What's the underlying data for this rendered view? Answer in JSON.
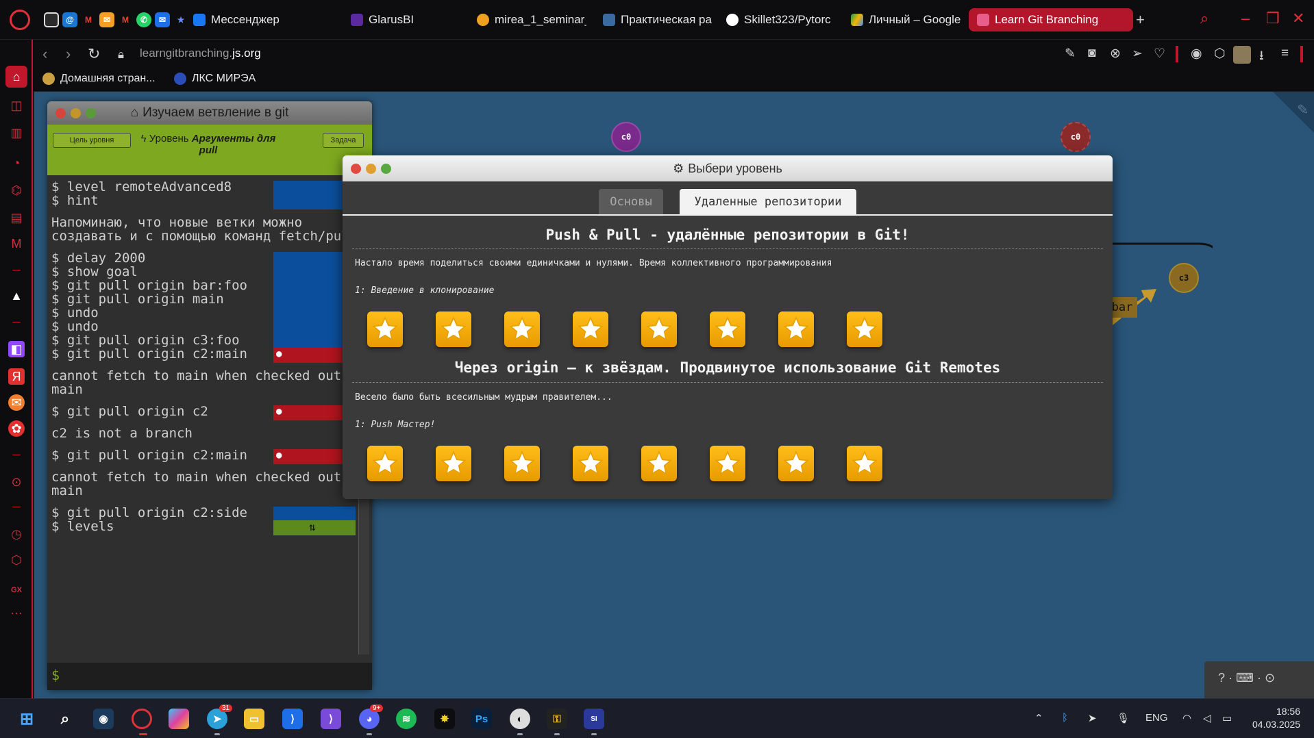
{
  "browser": {
    "tabs": [
      {
        "label": "Мессенджер"
      },
      {
        "label": "GlarusBI"
      },
      {
        "label": "mirea_1_seminar_"
      },
      {
        "label": "Практическая ра"
      },
      {
        "label": "Skillet323/Pytorc"
      },
      {
        "label": "Личный – Google"
      },
      {
        "label": "Learn Git Branching",
        "active": true
      }
    ],
    "new_tab_label": "+",
    "url_prefix": "learngitbranching.",
    "url_domain": "js.org",
    "bookmarks": [
      {
        "label": "Домашняя стран..."
      },
      {
        "label": "ЛКС МИРЭА"
      }
    ]
  },
  "terminal": {
    "title": "Изучаем ветвление в git",
    "goal_button": "Цель уровня",
    "task_button": "Задача",
    "level_prefix": "Уровень",
    "level_name": "Аргументы для pull",
    "lines": [
      {
        "text": "$ level remoteAdvanced8",
        "status": "blue"
      },
      {
        "text": "$ hint",
        "status": "blue"
      },
      {
        "text": "Напоминаю, что новые ветки можно",
        "status": ""
      },
      {
        "text": "создавать и с помощью команд fetch/pull",
        "status": ""
      },
      {
        "text": "$ delay 2000",
        "status": "blue"
      },
      {
        "text": "$ show goal",
        "status": "blue"
      },
      {
        "text": "$ git pull origin bar:foo",
        "status": "blue"
      },
      {
        "text": "$ git pull origin main",
        "status": "blue"
      },
      {
        "text": "$ undo",
        "status": "blue"
      },
      {
        "text": "$ undo",
        "status": "blue"
      },
      {
        "text": "$ git pull origin c3:foo",
        "status": "blue"
      },
      {
        "text": "$ git pull origin c2:main",
        "status": "error"
      },
      {
        "text": "cannot fetch to main when checked out on",
        "status": ""
      },
      {
        "text": "main",
        "status": ""
      },
      {
        "text": "$ git pull origin c2",
        "status": "error"
      },
      {
        "text": "c2 is not a branch",
        "status": ""
      },
      {
        "text": "$ git pull origin c2:main",
        "status": "error"
      },
      {
        "text": "cannot fetch to main when checked out on",
        "status": ""
      },
      {
        "text": "main",
        "status": ""
      },
      {
        "text": "$ git pull origin c2:side",
        "status": "blue"
      },
      {
        "text": "$ levels",
        "status": "green"
      }
    ],
    "prompt": "$"
  },
  "graph": {
    "nodes": [
      {
        "label": "c0",
        "color": "#7a2a8a"
      },
      {
        "label": "c0",
        "color": "#8a2a2a"
      },
      {
        "label": "c3",
        "color": "#8a6a20"
      }
    ],
    "branch_label": "bar"
  },
  "dialog": {
    "title": "Выбери уровень",
    "tabs": [
      {
        "label": "Основы",
        "active": false
      },
      {
        "label": "Удаленные репозитории",
        "active": true
      }
    ],
    "sections": [
      {
        "title": "Push & Pull - удалённые репозитории в Git!",
        "description": "Настало время поделиться своими единичками и нулями. Время коллективного программирования",
        "subtitle": "1: Введение в клонирование",
        "stars": 8
      },
      {
        "title": "Через origin – к звёздам. Продвинутое использование Git Remotes",
        "description": "Весело было быть всесильным мудрым правителем...",
        "subtitle": "1: Push Мастер!",
        "stars": 8
      }
    ]
  },
  "help_box": {
    "text": "? · ⌨ · ⊙"
  },
  "taskbar": {
    "badges": {
      "telegram": "31",
      "discord": "9+"
    },
    "tray_lang": "ENG",
    "time": "18:56",
    "date": "04.03.2025"
  },
  "colors": {
    "accent": "#c0172b",
    "canvas": "#2a5578",
    "level_bar": "#7ea81f",
    "status_blue": "#0b4f9c",
    "status_red": "#b0141e",
    "status_green": "#5d8a1c",
    "star": "#ffb300"
  }
}
